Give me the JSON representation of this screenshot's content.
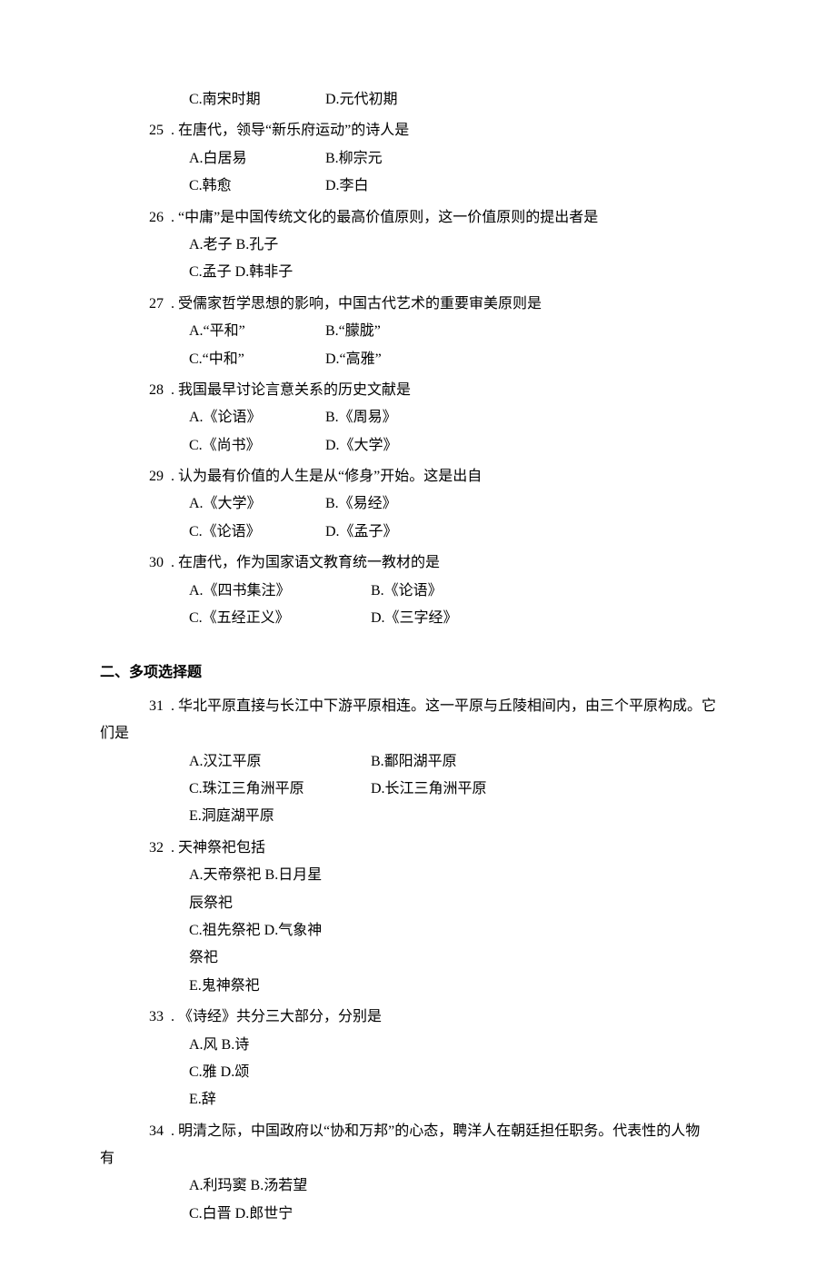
{
  "prev_question": {
    "optC": "C.南宋时期",
    "optD": "D.元代初期"
  },
  "sc_questions": [
    {
      "num": "25",
      "stem": "在唐代，领导“新乐府运动”的诗人是",
      "rows": [
        {
          "a": "A.白居易",
          "b": "B.柳宗元"
        },
        {
          "a": "C.韩愈",
          "b": "D.李白"
        }
      ]
    },
    {
      "num": "26",
      "stem": "“中庸”是中国传统文化的最高价值原则，这一价值原则的提出者是",
      "rows": [
        {
          "a": "A.老子 B.孔子",
          "b": ""
        },
        {
          "a": "C.孟子 D.韩非子",
          "b": ""
        }
      ]
    },
    {
      "num": "27",
      "stem": "受儒家哲学思想的影响，中国古代艺术的重要审美原则是",
      "rows": [
        {
          "a": "A.“平和”",
          "b": "B.“朦胧”"
        },
        {
          "a": "C.“中和”",
          "b": "D.“高雅”"
        }
      ]
    },
    {
      "num": "28",
      "stem": "我国最早讨论言意关系的历史文献是",
      "rows": [
        {
          "a": "A.《论语》",
          "b": "B.《周易》"
        },
        {
          "a": "C.《尚书》",
          "b": "D.《大学》"
        }
      ]
    },
    {
      "num": "29",
      "stem": "认为最有价值的人生是从“修身”开始。这是出自",
      "rows": [
        {
          "a": "A.《大学》",
          "b": "B.《易经》"
        },
        {
          "a": "C.《论语》",
          "b": "D.《孟子》"
        }
      ]
    },
    {
      "num": "30",
      "stem": "在唐代，作为国家语文教育统一教材的是",
      "rows": [
        {
          "a": "A.《四书集注》",
          "b": "B.《论语》"
        },
        {
          "a": "C.《五经正义》",
          "b": "D.《三字经》"
        }
      ],
      "wide": true
    }
  ],
  "section2_title": "二、多项选择题",
  "mc_q31": {
    "num": "31",
    "line1": "华北平原直接与长江中下游平原相连。这一平原与丘陵相间内，由三个平原构成。它",
    "line2": "们是",
    "rows": [
      {
        "a": "A.汉江平原",
        "b": "B.鄱阳湖平原"
      },
      {
        "a": "C.珠江三角洲平原",
        "b": "D.长江三角洲平原"
      },
      {
        "a": "E.洞庭湖平原",
        "b": ""
      }
    ]
  },
  "mc_q32": {
    "num": "32",
    "stem": "天神祭祀包括",
    "rows": [
      {
        "a": "A.天帝祭祀 B.日月星辰祭祀",
        "b": ""
      },
      {
        "a": "C.祖先祭祀 D.气象神祭祀",
        "b": ""
      },
      {
        "a": "E.鬼神祭祀",
        "b": ""
      }
    ]
  },
  "mc_q33": {
    "num": "33",
    "stem": "《诗经》共分三大部分，分别是",
    "rows": [
      {
        "a": "A.风 B.诗",
        "b": ""
      },
      {
        "a": "C.雅 D.颂",
        "b": ""
      },
      {
        "a": "E.辞",
        "b": ""
      }
    ]
  },
  "mc_q34": {
    "num": "34",
    "line1": "明清之际，中国政府以“协和万邦”的心态，聘洋人在朝廷担任职务。代表性的人物",
    "line2": "有",
    "rows": [
      {
        "a": "A.利玛窦 B.汤若望",
        "b": ""
      },
      {
        "a": "C.白晋 D.郎世宁",
        "b": ""
      }
    ]
  }
}
